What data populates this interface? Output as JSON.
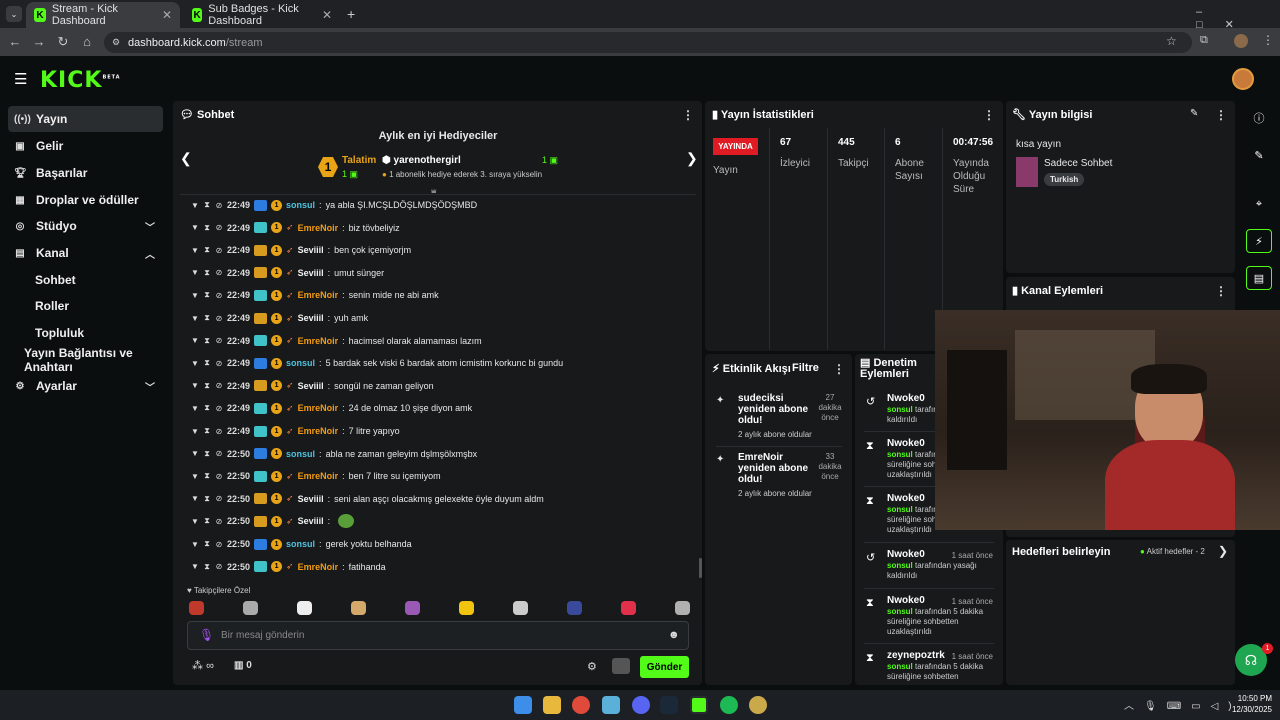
{
  "browser": {
    "tabs": [
      {
        "title": "Stream - Kick Dashboard"
      },
      {
        "title": "Sub Badges - Kick Dashboard"
      }
    ],
    "url": "dashboard.kick.com/stream",
    "url_host": "dashboard.kick.com",
    "url_path": "/stream"
  },
  "app": {
    "logo": "KICK",
    "beta": "BETA"
  },
  "sidebar": {
    "items": [
      "Yayın",
      "Gelir",
      "Başarılar",
      "Droplar ve ödüller",
      "Stüdyo",
      "Kanal",
      "Sohbet",
      "Roller",
      "Topluluk",
      "Yayın Bağlantısı ve Anahtarı",
      "Ayarlar"
    ]
  },
  "chat": {
    "title": "Sohbet",
    "gifters_title": "Aylık en iyi Hediyeciler",
    "gifter1": {
      "rank": "1",
      "name": "Talatim",
      "count": "1"
    },
    "gifter2": {
      "name": "yarenothergirl",
      "count": "1",
      "note": "1 abonelik hediye ederek 3. sıraya yükselin"
    },
    "messages": [
      {
        "time": "22:49",
        "user": "sonsul",
        "color": "#4ec3e0",
        "text": "ya abla ŞI.MCŞLDÖŞLMDŞÖDŞMBD",
        "b": "#2d7de0"
      },
      {
        "time": "22:49",
        "user": "EmreNoir",
        "color": "#f39c12",
        "text": "biz tövbeliyiz",
        "b": "#3fc3c8"
      },
      {
        "time": "22:49",
        "user": "Seviiil",
        "color": "#f0f0f0",
        "text": "ben çok içemiyorjm",
        "b": "#d79b1f"
      },
      {
        "time": "22:49",
        "user": "Seviiil",
        "color": "#f0f0f0",
        "text": "umut sünger",
        "b": "#d79b1f"
      },
      {
        "time": "22:49",
        "user": "EmreNoir",
        "color": "#f39c12",
        "text": "senin mide ne abi amk",
        "b": "#3fc3c8"
      },
      {
        "time": "22:49",
        "user": "Seviiil",
        "color": "#f0f0f0",
        "text": "yuh amk",
        "b": "#d79b1f"
      },
      {
        "time": "22:49",
        "user": "EmreNoir",
        "color": "#f39c12",
        "text": "hacimsel olarak alamaması lazım",
        "b": "#3fc3c8"
      },
      {
        "time": "22:49",
        "user": "sonsul",
        "color": "#4ec3e0",
        "text": "5 bardak sek viski 6 bardak atom icmistim korkunc bi gundu",
        "b": "#2d7de0"
      },
      {
        "time": "22:49",
        "user": "Seviiil",
        "color": "#f0f0f0",
        "text": "songül ne zaman geliyon",
        "b": "#d79b1f"
      },
      {
        "time": "22:49",
        "user": "EmreNoir",
        "color": "#f39c12",
        "text": "24 de olmaz 10 şişe diyon amk",
        "b": "#3fc3c8"
      },
      {
        "time": "22:49",
        "user": "EmreNoir",
        "color": "#f39c12",
        "text": "7 litre yapıyo",
        "b": "#3fc3c8"
      },
      {
        "time": "22:50",
        "user": "sonsul",
        "color": "#4ec3e0",
        "text": "abla ne zaman geleyim dşlmşölxmşbx",
        "b": "#2d7de0"
      },
      {
        "time": "22:50",
        "user": "EmreNoir",
        "color": "#f39c12",
        "text": "ben 7 litre su içemiyom",
        "b": "#3fc3c8"
      },
      {
        "time": "22:50",
        "user": "Seviiil",
        "color": "#f0f0f0",
        "text": "seni alan aşçı olacakmış gelexekte öyle duyum aldm",
        "b": "#d79b1f"
      },
      {
        "time": "22:50",
        "user": "Seviiil",
        "color": "#f0f0f0",
        "text": "",
        "b": "#d79b1f"
      },
      {
        "time": "22:50",
        "user": "sonsul",
        "color": "#4ec3e0",
        "text": "gerek yoktu belhanda",
        "b": "#2d7de0"
      },
      {
        "time": "22:50",
        "user": "EmreNoir",
        "color": "#f39c12",
        "text": "fatihanda",
        "b": "#3fc3c8"
      }
    ],
    "followers_only": "Takipçilere Özel",
    "placeholder": "Bir mesaj gönderin",
    "infinity": "∞",
    "count": "0",
    "send": "Gönder"
  },
  "stats": {
    "title": "Yayın İstatistikleri",
    "live": "YAYINDA",
    "live_label": "Yayın",
    "items": [
      {
        "v": "67",
        "l": "İzleyici"
      },
      {
        "v": "445",
        "l": "Takipçi"
      },
      {
        "v": "6",
        "l": "Abone Sayısı"
      },
      {
        "v": "00:47:56",
        "l": "Yayında Olduğu Süre"
      }
    ]
  },
  "info": {
    "title": "Yayın bilgisi",
    "stream_title": "kısa yayın",
    "category": "Sadece Sohbet",
    "tag": "Turkish"
  },
  "channel_actions": {
    "title": "Kanal Eylemleri"
  },
  "activity": {
    "title": "Etkinlik Akışı",
    "filter": "Filtre",
    "items": [
      {
        "text": "sudeciksi yeniden abone oldu!",
        "sub": "2 aylık abone oldular",
        "months": "2",
        "n": "27",
        "ago": "dakika önce"
      },
      {
        "text": "EmreNoir yeniden abone oldu!",
        "sub": "2 aylık abone oldular",
        "months": "2",
        "n": "33",
        "ago": "dakika önce"
      }
    ]
  },
  "moderation": {
    "title": "Denetim Eylemleri",
    "items": [
      {
        "name": "Nwoke0",
        "time": "",
        "pre": "sonsul",
        "text": "tarafından yasağı kaldırıldı"
      },
      {
        "name": "Nwoke0",
        "time": "",
        "pre": "sonsul",
        "text": "tarafından 5 dakika süreliğine sohbetten uzaklaştırıldı"
      },
      {
        "name": "Nwoke0",
        "time": "",
        "pre": "sonsul",
        "text": "tarafından 5 dakika süreliğine sohbetten uzaklaştırıldı"
      },
      {
        "name": "Nwoke0",
        "time": "1 saat önce",
        "pre": "sonsul",
        "text": "tarafından yasağı kaldırıldı"
      },
      {
        "name": "Nwoke0",
        "time": "1 saat önce",
        "pre": "sonsul",
        "text": "tarafından 5 dakika süreliğine sohbetten uzaklaştırıldı"
      },
      {
        "name": "zeynepoztrk",
        "time": "1 saat önce",
        "pre": "sonsul",
        "text": "tarafından 5 dakika süreliğine sohbetten"
      }
    ]
  },
  "goals": {
    "title": "Hedefleri belirleyin",
    "active": "Aktif hedefler - 2"
  },
  "taskbar": {
    "time": "10:50 PM",
    "date": "12/30/2025"
  },
  "support": {
    "count": "1"
  }
}
